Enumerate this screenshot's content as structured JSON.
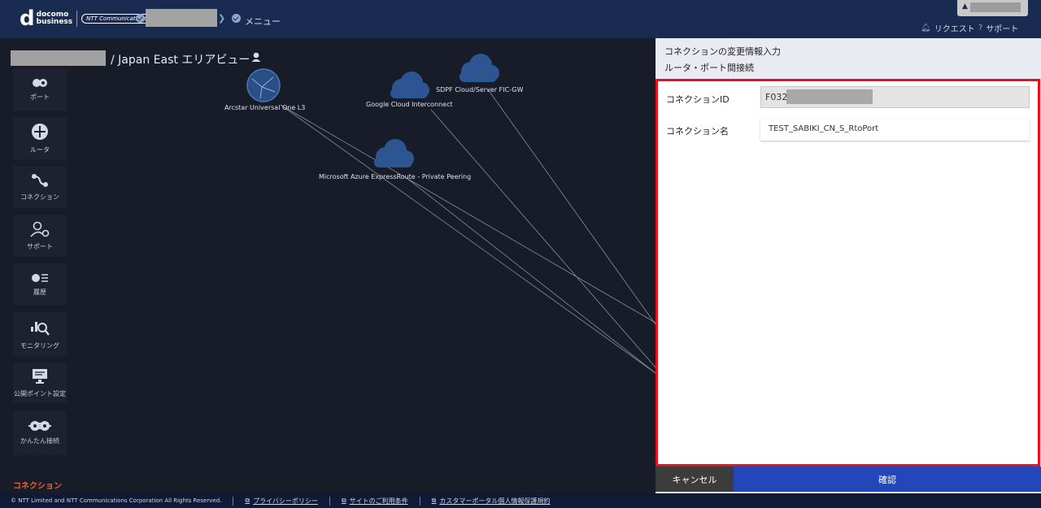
{
  "header": {
    "logo_docomo": "docomo",
    "logo_business": "business",
    "logo_ntt": "NTT Communications",
    "menu_label": "メニュー",
    "request_label": "リクエスト",
    "support_label": "サポート"
  },
  "page": {
    "title": "/ Japan East エリアビュー"
  },
  "sidebar": {
    "items": [
      {
        "label": "ポート",
        "icon": "port-icon"
      },
      {
        "label": "ルータ",
        "icon": "router-icon"
      },
      {
        "label": "コネクション",
        "icon": "connection-icon"
      },
      {
        "label": "サポート",
        "icon": "support-user-icon"
      },
      {
        "label": "履歴",
        "icon": "history-icon"
      },
      {
        "label": "モニタリング",
        "icon": "monitoring-icon"
      },
      {
        "label": "公開ポイント設定",
        "icon": "monitor-icon"
      },
      {
        "label": "かんたん接続",
        "icon": "plug-icon"
      }
    ],
    "section_label": "コネクション"
  },
  "map": {
    "nodes": [
      {
        "label": "Arcstar Universal One L3",
        "icon": "globe-icon"
      },
      {
        "label": "Google Cloud Interconnect",
        "icon": "cloud-icon"
      },
      {
        "label": "SDPF Cloud/Server FIC-GW",
        "icon": "cloud-icon"
      },
      {
        "label": "Microsoft Azure ExpressRoute - Private Peering",
        "icon": "cloud-icon"
      }
    ]
  },
  "panel": {
    "heading": "コネクションの変更情報入力",
    "subheading": "ルータ・ポート間接続",
    "connection_id_label": "コネクションID",
    "connection_id_value": "F032",
    "connection_name_label": "コネクション名",
    "connection_name_value": "TEST_SABIKI_CN_S_RtoPort",
    "cancel_label": "キャンセル",
    "confirm_label": "確認"
  },
  "footer": {
    "copyright": "© NTT Limited and NTT Communications Corporation All Rights Reserved.",
    "links": [
      "プライバシーポリシー",
      "サイトのご利用条件",
      "カスタマーポータル個人情報保護規約"
    ]
  },
  "colors": {
    "header_bg": "#1a2b52",
    "highlight_border": "#e8101c",
    "confirm_button": "#2347b8",
    "section_accent": "#e06a30"
  }
}
